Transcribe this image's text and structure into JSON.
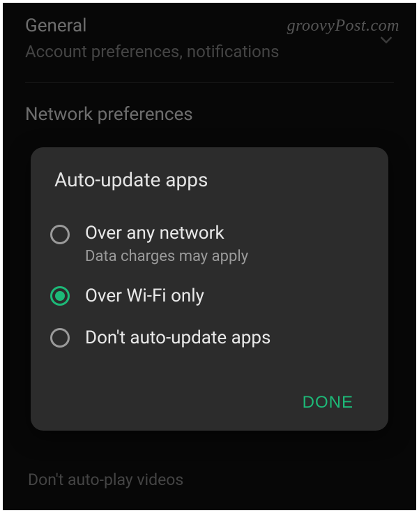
{
  "watermark": "groovyPost.com",
  "background": {
    "section1": {
      "title": "General",
      "subtitle": "Account preferences, notifications"
    },
    "section2": {
      "title": "Network preferences"
    },
    "bottom": "Don't auto-play videos"
  },
  "dialog": {
    "title": "Auto-update apps",
    "options": [
      {
        "label": "Over any network",
        "sublabel": "Data charges may apply",
        "selected": false
      },
      {
        "label": "Over Wi-Fi only",
        "selected": true
      },
      {
        "label": "Don't auto-update apps",
        "selected": false
      }
    ],
    "done": "DONE"
  }
}
